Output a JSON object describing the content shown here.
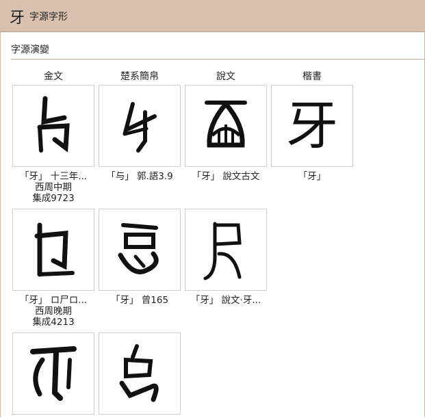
{
  "header": {
    "char": "牙",
    "title": "字源字形"
  },
  "section": {
    "title": "字源演變"
  },
  "columns": [
    "金文",
    "楚系簡帛",
    "說文",
    "楷書"
  ],
  "rows": [
    [
      {
        "caption": "「牙」 十三年...",
        "period": "西周中期",
        "source": "集成9723"
      },
      {
        "caption": "「与」 郭.語3.9"
      },
      {
        "caption": "「牙」 說文古文"
      },
      {
        "caption": "「牙」",
        "glyph": "牙"
      }
    ],
    [
      {
        "caption": "「牙」 ロ尸ロ...",
        "period": "西周晚期",
        "source": "集成4213"
      },
      {
        "caption": "「牙」 曾165"
      },
      {
        "caption": "「牙」 說文·牙..."
      }
    ],
    [
      {
        "caption": ""
      },
      {
        "caption": ""
      }
    ]
  ]
}
